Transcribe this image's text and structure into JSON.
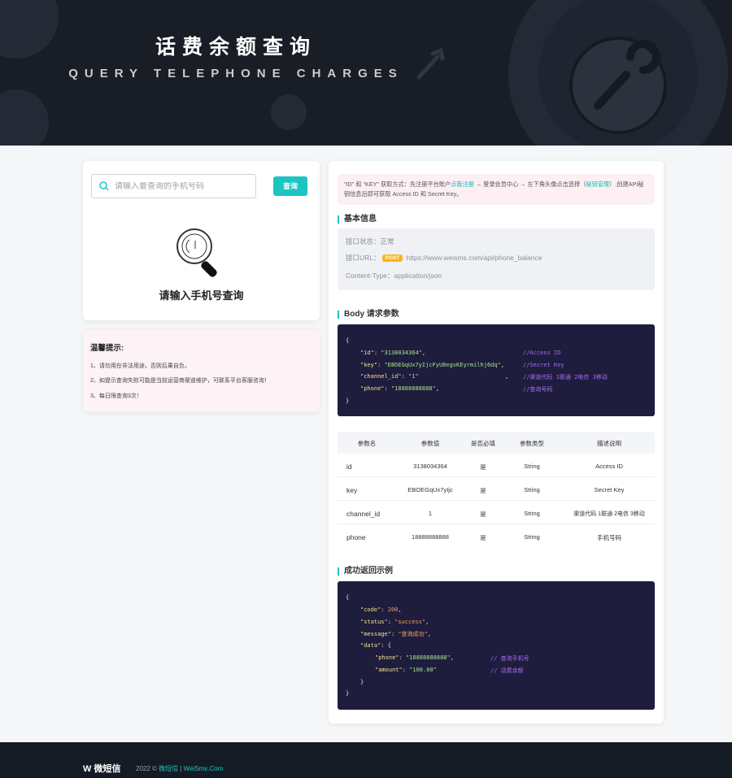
{
  "banner": {
    "title": "话费余额查询",
    "subtitle": "QUERY TELEPHONE CHARGES"
  },
  "search": {
    "placeholder": "请输入要查询的手机号码",
    "button_label": "查询",
    "empty_text": "请输入手机号查询"
  },
  "tips": {
    "title": "温馨提示:",
    "items": [
      "1、请勿用在非法用途，否则后果自负。",
      "2、如提示查询失败可能是当前运营商渠道维护，可联系平台客服咨询！",
      "3、每日限查询3次！"
    ]
  },
  "notice": {
    "part1": "\"ID\" 和 \"KEY\" 获取方式：先注册平台账户",
    "register_link": "点我注册",
    "part2": " → 登录会员中心 → 左下角头像点击选择（",
    "key_link": "秘钥管理",
    "part3": "）,创建API秘钥信息后即可获取 Access ID 和 Secret Key。"
  },
  "basic_info": {
    "title": "基本信息",
    "status_label": "接口状态：",
    "status_value": "正常",
    "url_label": "接口URL：",
    "method": "POST",
    "url": "https://www.weisms.com/api/phone_balance",
    "content_type_label": "Content-Type：",
    "content_type": "application/json"
  },
  "body_params": {
    "title": "Body 请求参数",
    "lines": [
      {
        "key": "\"id\"",
        "value": "\"3138034364\"",
        "comment": "//Access ID"
      },
      {
        "key": "\"key\"",
        "value": "\"EBOEGqUx7yIjcFyU8egvKEyrmilhj6dq\"",
        "comment": "//Secret Key"
      },
      {
        "key": "\"channel_id\"",
        "value": "\"1\"",
        "comment": "//渠道代码 1联通 2电信 3移动"
      },
      {
        "key": "\"phone\"",
        "value": "\"18888888888\"",
        "comment": "//查询号码"
      }
    ]
  },
  "param_table": {
    "headers": [
      "参数名",
      "参数值",
      "是否必填",
      "参数类型",
      "描述说明"
    ],
    "rows": [
      [
        "id",
        "3138034364",
        "是",
        "String",
        "Access ID"
      ],
      [
        "key",
        "EBOEGqUx7yIjc",
        "是",
        "String",
        "Secret Key"
      ],
      [
        "channel_id",
        "1",
        "是",
        "String",
        "渠道代码 1联通 2电信 3移动"
      ],
      [
        "phone",
        "18888888888",
        "是",
        "String",
        "手机号码"
      ]
    ]
  },
  "success_example": {
    "title": "成功返回示例",
    "code_key": "\"code\"",
    "code_val": "200",
    "status_key": "\"status\"",
    "status_val": "\"success\"",
    "message_key": "\"message\"",
    "message_val": "\"查询成功\"",
    "data_key": "\"data\"",
    "phone_key": "\"phone\"",
    "phone_val": "\"18888888888\"",
    "phone_comment": "// 查询手机号",
    "amount_key": "\"amount\"",
    "amount_val": "\"100.00\"",
    "amount_comment": "// 话费余额"
  },
  "footer": {
    "logo": "微短信",
    "copy": "2022 © ",
    "brand": "微短信",
    "sep": " | ",
    "site": "WeiSms.Com"
  }
}
